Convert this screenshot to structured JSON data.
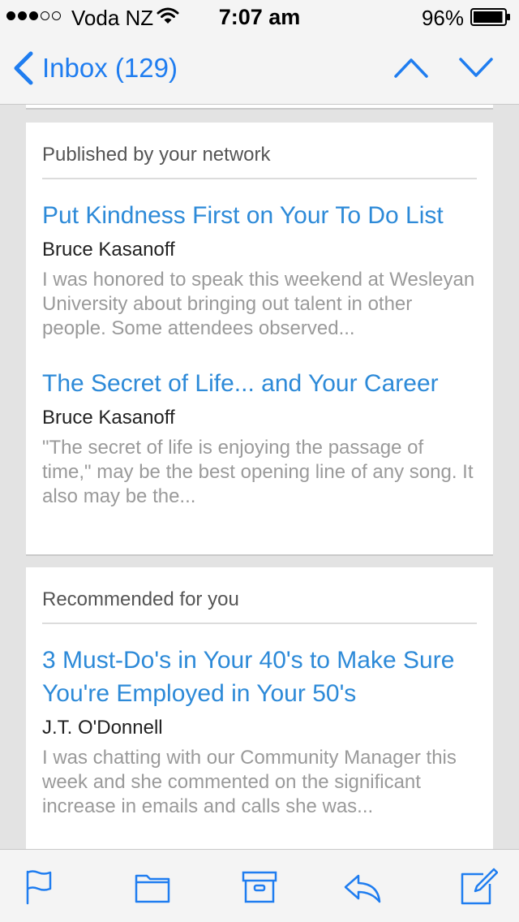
{
  "status_bar": {
    "carrier": "Voda NZ",
    "time": "7:07 am",
    "battery_percent": "96%",
    "signal_bars_filled": 3,
    "signal_bars_total": 5,
    "battery_level": 0.96
  },
  "nav": {
    "back_label": "Inbox (129)",
    "back_icon": "chevron-left-icon",
    "prev_icon": "chevron-up-icon",
    "next_icon": "chevron-down-icon",
    "accent_color": "#1f7df0"
  },
  "sections": [
    {
      "header": "Published by your network",
      "articles": [
        {
          "title": "Put Kindness First on Your To Do List",
          "author": "Bruce Kasanoff",
          "snippet": "I was honored to speak this weekend at Wesleyan University about bringing out talent in other people. Some attendees observed..."
        },
        {
          "title": "The Secret of Life... and Your Career",
          "author": "Bruce Kasanoff",
          "snippet": "\"The secret of life is enjoying the passage of time,\" may be the best opening line of any song. It also may be the..."
        }
      ]
    },
    {
      "header": "Recommended for you",
      "articles": [
        {
          "title": "3 Must-Do's in Your 40's to Make Sure You're Employed in Your 50's",
          "author": "J.T. O'Donnell",
          "snippet": "I was chatting with our Community Manager this week and she commented on the significant increase in emails and calls she was..."
        }
      ]
    }
  ],
  "toolbar": {
    "icons": [
      "flag-icon",
      "folder-icon",
      "archive-icon",
      "reply-icon",
      "compose-icon"
    ]
  },
  "colors": {
    "link_blue": "#2d8ad8",
    "snippet_gray": "#9a9a9a",
    "background": "#e3e3e3"
  }
}
